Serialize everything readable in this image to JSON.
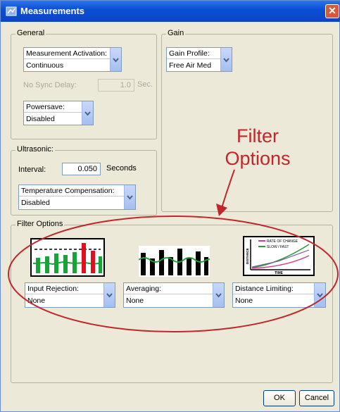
{
  "window": {
    "title": "Measurements",
    "close_glyph": "✕"
  },
  "general": {
    "label": "General",
    "activation": {
      "label": "Measurement Activation:",
      "value": "Continuous"
    },
    "sync_delay": {
      "label": "No Sync Delay:",
      "value": "1.0",
      "unit": "Sec."
    },
    "powersave": {
      "label": "Powersave:",
      "value": "Disabled"
    }
  },
  "gain": {
    "label": "Gain",
    "profile": {
      "label": "Gain Profile:",
      "value": "Free Air Med"
    }
  },
  "ultrasonic": {
    "label": "Ultrasonic:",
    "interval": {
      "label": "Interval:",
      "value": "0.050",
      "unit": "Seconds"
    },
    "temp_comp": {
      "label": "Temperature Compensation:",
      "value": "Disabled"
    }
  },
  "filter": {
    "label": "Filter Options",
    "input_rejection": {
      "label": "Input Rejection:",
      "value": "None"
    },
    "averaging": {
      "label": "Averaging:",
      "value": "None"
    },
    "distance_limiting": {
      "label": "Distance Limiting:",
      "value": "None"
    },
    "graph": {
      "rate_of_change": "RATE OF CHANGE",
      "slow_fast": "SLOW / FAST",
      "time": "TIME",
      "distance": "DISTANCE"
    }
  },
  "annotation": {
    "line1": "Filter",
    "line2": "Options"
  },
  "buttons": {
    "ok": "OK",
    "cancel": "Cancel"
  },
  "colors": {
    "title_bar": "#0b4fd6",
    "annotation": "#c0272d",
    "dialog_bg": "#ece9d8"
  }
}
